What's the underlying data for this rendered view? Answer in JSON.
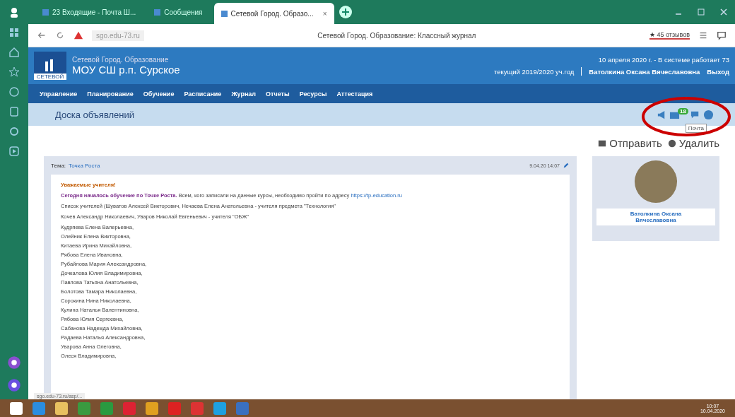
{
  "browser": {
    "tabs": [
      {
        "title": "23 Входящие - Почта Ш...",
        "selected": false
      },
      {
        "title": "Сообщения",
        "selected": false
      },
      {
        "title": "Сетевой Город. Образо...",
        "selected": true
      }
    ],
    "close_mark": "×",
    "address": "sgo.edu-73.ru",
    "page_title": "Сетевой Город. Образование: Классный журнал",
    "reviews": "★ 45 отзывов"
  },
  "site": {
    "org_label": "Сетевой Город. Образование",
    "school": "МОУ СШ р.п. Сурское",
    "logo_caption": "СЕТЕВОЙ",
    "date_line": "10 апреля 2020 г. - В системе работает 73",
    "year": "текущий 2019/2020 уч.год",
    "user": "Ватолкина Оксана Вячеславовна",
    "logout": "Выход",
    "menu": [
      "Управление",
      "Планирование",
      "Обучение",
      "Расписание",
      "Журнал",
      "Отчеты",
      "Ресурсы",
      "Аттестация"
    ],
    "board_title": "Доска объявлений",
    "mail_badge": "18",
    "tooltip": "Почта",
    "actions": [
      {
        "kind": "send",
        "label": "Отправить"
      },
      {
        "kind": "delete",
        "label": "Удалить"
      }
    ]
  },
  "post": {
    "topic_label": "Тема:",
    "topic": "Точка Роста",
    "date": "9.04.20 14:07",
    "greeting": "Уважаемые учителя!",
    "lead": "**Сегодня началось обучение по Точке Роста.** Всем, кого записали на данные курсы, необходимо пройти по адресу",
    "link": "https://tp-education.ru",
    "lines": [
      "Список учителей (Шуватов Алексей Викторович, Нечаева Елена Анатольевна - учителя предмета \"Технология\"",
      "Кочев Александр Николаевич, Уваров Николай Евгеньевич - учителя \"ОБЖ\""
    ],
    "names": [
      "Кудряева Елена Валерьевна,",
      "Олейник Елена Викторовна,",
      "Китаева Ирина Михайловна,",
      "Рябова Елена Ивановна,",
      "Рубайлова Мария Александровна,",
      "Дочкалова Юлия Владимировна,",
      "Павлова Татьяна Анатольевна,",
      "Болотова Тамара Николаевна,",
      "Сорокина Нина Николаевна,",
      "Кулина Наталья Валентиновна,",
      "Рябова Юлия Сергеевна,",
      "Сабанова Надежда Михайловна,",
      "Радаева Наталья Александровна,",
      "Уварова Анна Олеговна,",
      "Олеся Владимировна,"
    ],
    "author": "Ватолкина Оксана Вячеславовна"
  },
  "status_url": "sgo.edu-73.ru/asp/...",
  "clock": {
    "time": "10:07",
    "date": "10.04.2020"
  }
}
